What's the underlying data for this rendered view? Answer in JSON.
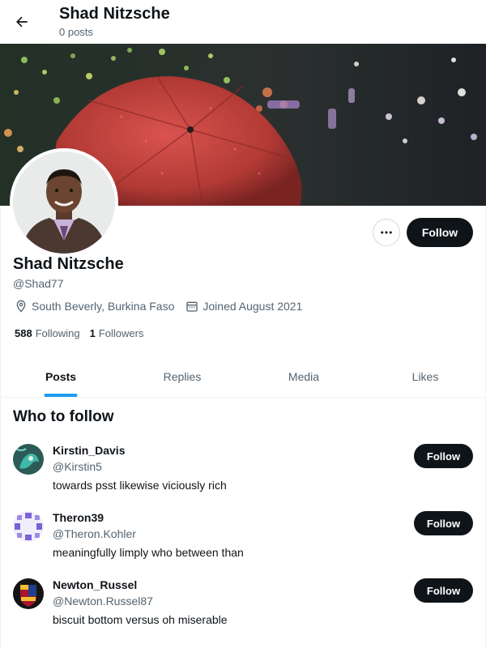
{
  "header": {
    "title": "Shad Nitzsche",
    "subtitle": "0 posts",
    "back_icon": "arrow-left-icon"
  },
  "profile": {
    "name": "Shad Nitzsche",
    "handle": "@Shad77",
    "location": "South Beverly, Burkina Faso",
    "joined": "Joined August 2021",
    "following_count": "588",
    "following_label": "Following",
    "followers_count": "1",
    "followers_label": "Followers",
    "follow_label": "Follow",
    "more_icon": "more-horizontal-icon"
  },
  "tabs": [
    {
      "label": "Posts",
      "active": true
    },
    {
      "label": "Replies",
      "active": false
    },
    {
      "label": "Media",
      "active": false
    },
    {
      "label": "Likes",
      "active": false
    }
  ],
  "who_to_follow": {
    "title": "Who to follow",
    "users": [
      {
        "name": "Kirstin_Davis",
        "handle": "@Kirstin5",
        "bio": "towards psst likewise viciously rich",
        "follow_label": "Follow"
      },
      {
        "name": "Theron39",
        "handle": "@Theron.Kohler",
        "bio": "meaningfully limply who between than",
        "follow_label": "Follow"
      },
      {
        "name": "Newton_Russel",
        "handle": "@Newton.Russel87",
        "bio": "biscuit bottom versus oh miserable",
        "follow_label": "Follow"
      }
    ]
  },
  "colors": {
    "accent": "#1d9bf0",
    "button_dark": "#0f1419",
    "muted_text": "#536471"
  }
}
